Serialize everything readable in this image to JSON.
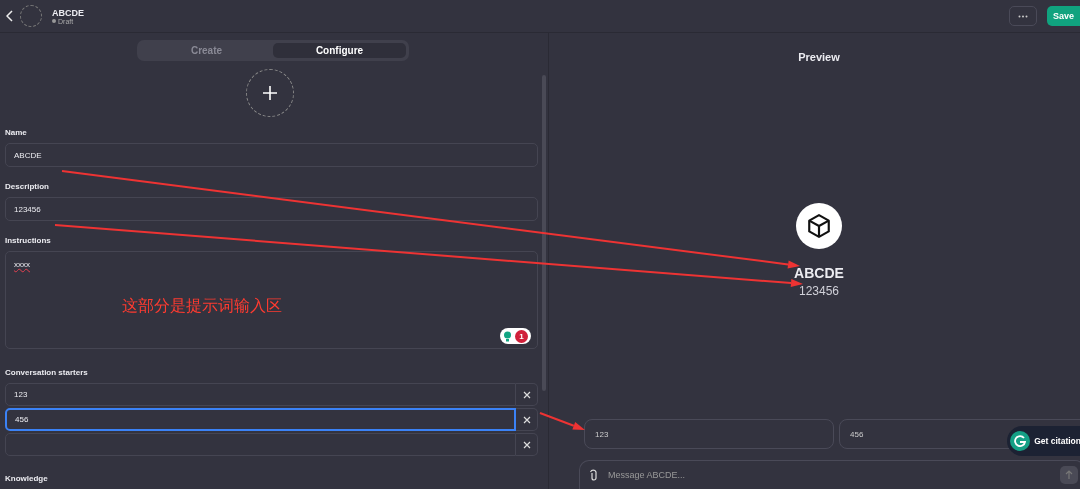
{
  "header": {
    "title": "ABCDE",
    "status": "Draft"
  },
  "actions": {
    "save": "Save"
  },
  "tabs": [
    {
      "label": "Create",
      "selected": false
    },
    {
      "label": "Configure",
      "selected": true
    }
  ],
  "form": {
    "name": {
      "label": "Name",
      "value": "ABCDE"
    },
    "description": {
      "label": "Description",
      "value": "123456"
    },
    "instructions": {
      "label": "Instructions",
      "value": "xxxx",
      "misspelled": true,
      "issue_count": "1"
    },
    "starters_label": "Conversation starters",
    "starters": [
      {
        "value": "123",
        "focused": false
      },
      {
        "value": "456",
        "focused": true
      },
      {
        "focused": false
      }
    ],
    "knowledge_label": "Knowledge"
  },
  "preview": {
    "title": "Preview",
    "name": "ABCDE",
    "description": "123456",
    "starters": [
      "123",
      "456"
    ],
    "citation_button": "Get citation",
    "message_placeholder": "Message ABCDE..."
  },
  "annotation": {
    "note": "这部分是提示词输入区"
  }
}
